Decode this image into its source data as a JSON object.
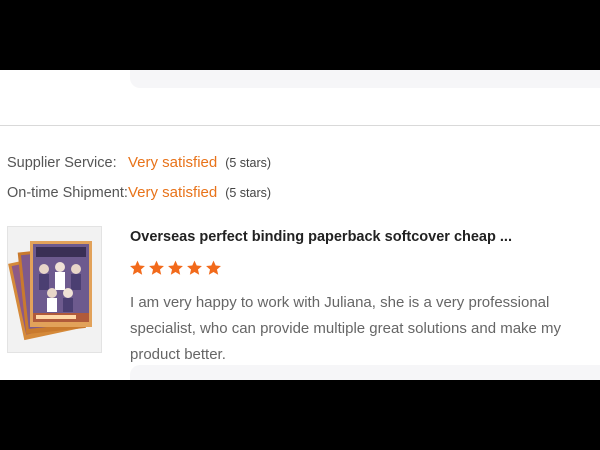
{
  "ratings": [
    {
      "label": "Supplier Service:",
      "value": "Very satisfied",
      "count": "(5 stars)"
    },
    {
      "label": "On-time Shipment:",
      "value": "Very satisfied",
      "count": "(5 stars)"
    }
  ],
  "review": {
    "product_title": "Overseas perfect binding paperback softcover cheap ...",
    "star_rating": 5,
    "star_max": 5,
    "star_color": "#f26a1b",
    "text": "I am very happy to work with Juliana, she is a very professional specialist, who can provide multiple great solutions and make my product better.",
    "thumbnail_icon": "magazine-cover-image"
  },
  "colors": {
    "accent_orange": "#e8731a",
    "label_gray": "#555555",
    "card_background": "#f6f6f8"
  }
}
